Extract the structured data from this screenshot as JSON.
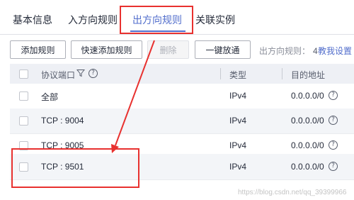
{
  "tabs": [
    "基本信息",
    "入方向规则",
    "出方向规则",
    "关联实例"
  ],
  "toolbar": {
    "add_label": "添加规则",
    "quick_add_label": "快速添加规则",
    "delete_label": "删除",
    "one_click_label": "一键放通",
    "rule_count_label": "出方向规则：",
    "rule_count_value": "4",
    "teach_label": "教我设置"
  },
  "table": {
    "headers": {
      "port": "协议端口",
      "type": "类型",
      "dest": "目的地址"
    },
    "rows": [
      {
        "port": "全部",
        "type": "IPv4",
        "dest": "0.0.0.0/0"
      },
      {
        "port": "TCP : 9004",
        "type": "IPv4",
        "dest": "0.0.0.0/0"
      },
      {
        "port": "TCP : 9005",
        "type": "IPv4",
        "dest": "0.0.0.0/0"
      },
      {
        "port": "TCP : 9501",
        "type": "IPv4",
        "dest": "0.0.0.0/0"
      }
    ]
  },
  "watermark": "https://blog.csdn.net/qq_39399966",
  "colors": {
    "accent": "#526ecc",
    "highlight": "#e8312f"
  }
}
